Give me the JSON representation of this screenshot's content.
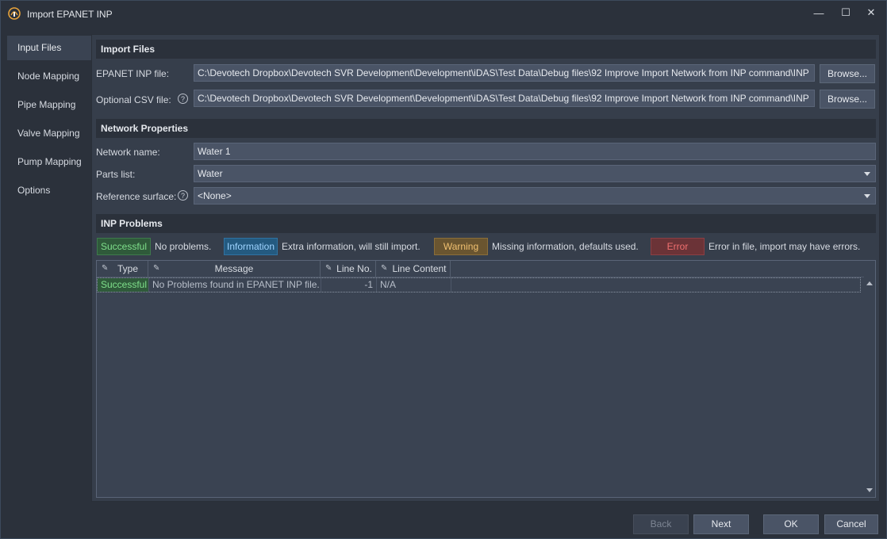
{
  "window": {
    "title": "Import EPANET INP",
    "minimize_glyph": "—",
    "maximize_glyph": "☐",
    "close_glyph": "✕"
  },
  "sidebar": {
    "items": [
      {
        "label": "Input Files",
        "active": true
      },
      {
        "label": "Node Mapping",
        "active": false
      },
      {
        "label": "Pipe Mapping",
        "active": false
      },
      {
        "label": "Valve Mapping",
        "active": false
      },
      {
        "label": "Pump Mapping",
        "active": false
      },
      {
        "label": "Options",
        "active": false
      }
    ]
  },
  "import_files": {
    "header": "Import Files",
    "inp_label": "EPANET INP file:",
    "inp_value": "C:\\Devotech Dropbox\\Devotech SVR Development\\Development\\iDAS\\Test Data\\Debug files\\92 Improve Import Network from INP command\\INP",
    "csv_label": "Optional CSV file:",
    "csv_value": "C:\\Devotech Dropbox\\Devotech SVR Development\\Development\\iDAS\\Test Data\\Debug files\\92 Improve Import Network from INP command\\INP",
    "browse_label": "Browse...",
    "help_glyph": "?"
  },
  "network_properties": {
    "header": "Network Properties",
    "name_label": "Network name:",
    "name_value": "Water 1",
    "parts_label": "Parts list:",
    "parts_value": "Water",
    "surface_label": "Reference surface:",
    "surface_value": "<None>"
  },
  "inp_problems": {
    "header": "INP Problems",
    "legend": [
      {
        "chip": "Successful",
        "text": "No problems."
      },
      {
        "chip": "Information",
        "text": "Extra information, will still import."
      },
      {
        "chip": "Warning",
        "text": "Missing information, defaults used."
      },
      {
        "chip": "Error",
        "text": "Error in file, import may have errors."
      }
    ],
    "columns": [
      "Type",
      "Message",
      "Line No.",
      "Line Content"
    ],
    "pin_glyph": "✎",
    "rows": [
      {
        "type": "Successful",
        "message": "No Problems found in EPANET INP file.",
        "line_no": "-1",
        "line_content": "N/A"
      }
    ]
  },
  "footer": {
    "back": "Back",
    "next": "Next",
    "ok": "OK",
    "cancel": "Cancel"
  },
  "colors": {
    "background": "#2b313b",
    "panel": "#363e4b",
    "field": "#4a5466",
    "success": "#7fe08b",
    "information": "#9fd4ff",
    "warning": "#f0c070",
    "error": "#f07070"
  }
}
